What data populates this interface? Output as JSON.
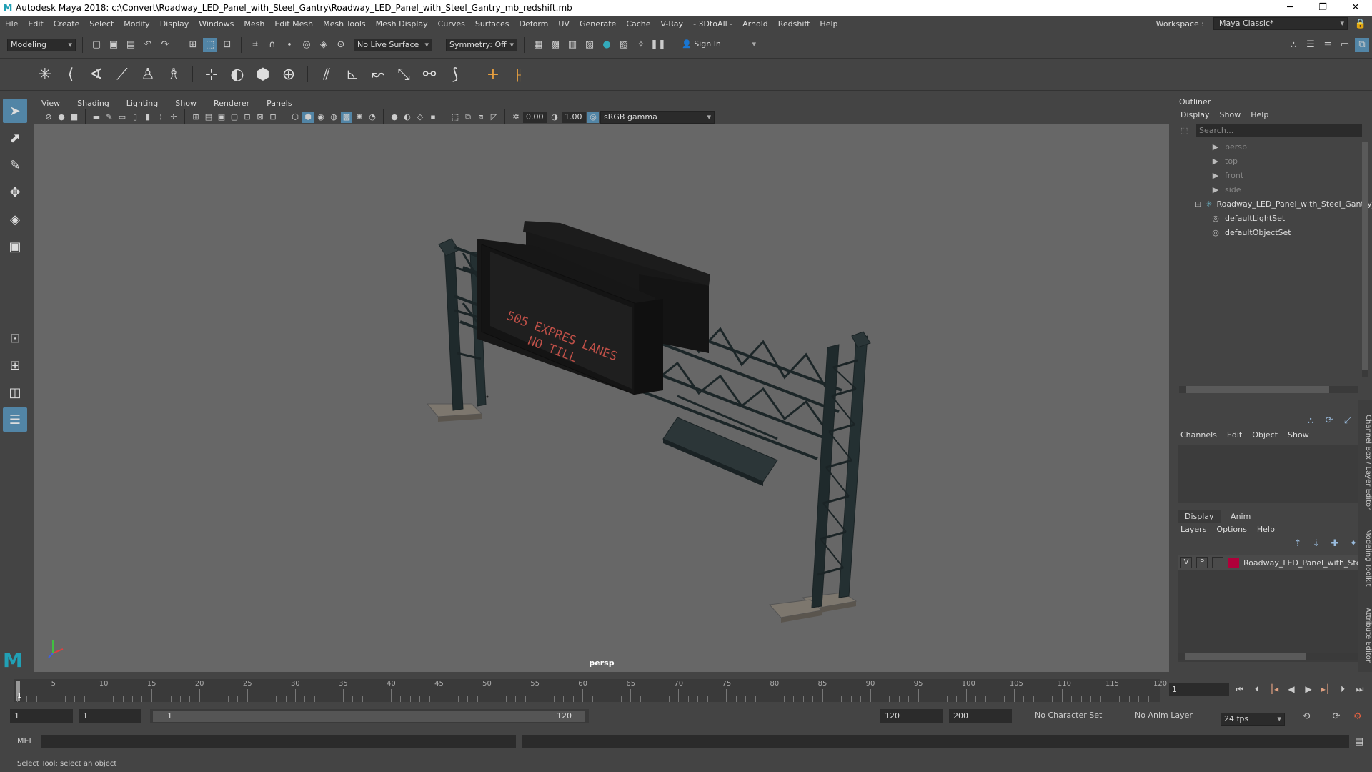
{
  "titlebar": {
    "text": "Autodesk Maya 2018: c:\\Convert\\Roadway_LED_Panel_with_Steel_Gantry\\Roadway_LED_Panel_with_Steel_Gantry_mb_redshift.mb",
    "logo": "M"
  },
  "menus": [
    "File",
    "Edit",
    "Create",
    "Select",
    "Modify",
    "Display",
    "Windows",
    "Mesh",
    "Edit Mesh",
    "Mesh Tools",
    "Mesh Display",
    "Curves",
    "Surfaces",
    "Deform",
    "UV",
    "Generate",
    "Cache",
    "V-Ray",
    "- 3DtoAll -",
    "Arnold",
    "Redshift",
    "Help"
  ],
  "workspace": {
    "label": "Workspace :",
    "value": "Maya Classic*"
  },
  "statusline": {
    "mode": "Modeling",
    "live_surface": "No Live Surface",
    "symmetry": "Symmetry: Off",
    "sign_in": "Sign In"
  },
  "viewport": {
    "menu": [
      "View",
      "Shading",
      "Lighting",
      "Show",
      "Renderer",
      "Panels"
    ],
    "exposure": "0.00",
    "gamma": "1.00",
    "colorspace": "sRGB gamma",
    "camera": "persp",
    "sign_text_line1": "505 EXPRES LANES",
    "sign_text_line2": "NO TILL"
  },
  "outliner": {
    "title": "Outliner",
    "menu": [
      "Display",
      "Show",
      "Help"
    ],
    "search_placeholder": "Search...",
    "items": [
      {
        "label": "persp",
        "icon": "camera-icon",
        "dim": true
      },
      {
        "label": "top",
        "icon": "camera-icon",
        "dim": true
      },
      {
        "label": "front",
        "icon": "camera-icon",
        "dim": true
      },
      {
        "label": "side",
        "icon": "camera-icon",
        "dim": true
      },
      {
        "label": "Roadway_LED_Panel_with_Steel_Gantry_",
        "icon": "transform-icon",
        "dim": false
      },
      {
        "label": "defaultLightSet",
        "icon": "set-icon",
        "dim": false
      },
      {
        "label": "defaultObjectSet",
        "icon": "set-icon",
        "dim": false
      }
    ]
  },
  "channelbox": {
    "menu": [
      "Channels",
      "Edit",
      "Object",
      "Show"
    ]
  },
  "layer_editor": {
    "tabs": [
      "Display",
      "Anim"
    ],
    "menu": [
      "Layers",
      "Options",
      "Help"
    ],
    "layer": {
      "v": "V",
      "p": "P",
      "name": "Roadway_LED_Panel_with_Ste",
      "color": "#b0003a"
    }
  },
  "side_tabs": [
    "Channel Box / Layer Editor",
    "Modeling Toolkit",
    "Attribute Editor"
  ],
  "timeline": {
    "tick_labels": [
      "5",
      "10",
      "15",
      "20",
      "25",
      "30",
      "35",
      "40",
      "45",
      "50",
      "55",
      "60",
      "65",
      "70",
      "75",
      "80",
      "85",
      "90",
      "95",
      "100",
      "105",
      "110",
      "115",
      "120"
    ],
    "start_label": "1",
    "current_frame": "1"
  },
  "range": {
    "start": "1",
    "anim_start": "1",
    "slider_start": "1",
    "slider_end": "120",
    "end": "120",
    "anim_end": "200",
    "character_set": "No Character Set",
    "anim_layer": "No Anim Layer",
    "fps": "24 fps"
  },
  "cmdline": {
    "label": "MEL"
  },
  "helpline": "Select Tool: select an object"
}
